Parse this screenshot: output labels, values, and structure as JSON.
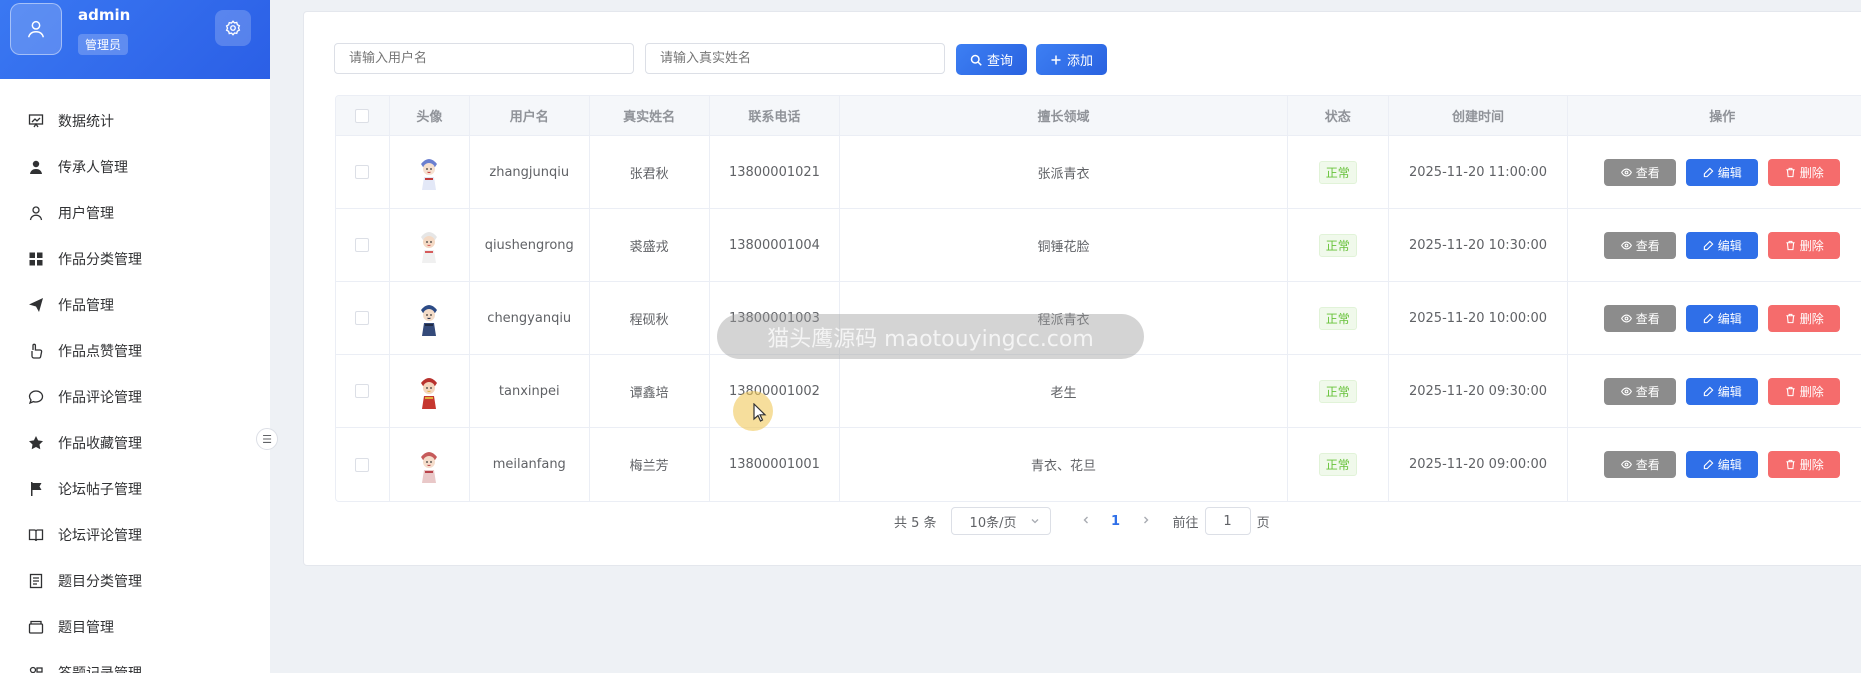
{
  "sidebar": {
    "profile": {
      "name": "admin",
      "role": "管理员"
    },
    "items": [
      {
        "label": "数据统计",
        "icon": "chart-board-icon"
      },
      {
        "label": "传承人管理",
        "icon": "user-filled-icon"
      },
      {
        "label": "用户管理",
        "icon": "user-icon"
      },
      {
        "label": "作品分类管理",
        "icon": "grid-icon"
      },
      {
        "label": "作品管理",
        "icon": "send-icon"
      },
      {
        "label": "作品点赞管理",
        "icon": "thumb-icon"
      },
      {
        "label": "作品评论管理",
        "icon": "comment-icon"
      },
      {
        "label": "作品收藏管理",
        "icon": "star-icon"
      },
      {
        "label": "论坛帖子管理",
        "icon": "flag-icon"
      },
      {
        "label": "论坛评论管理",
        "icon": "book-icon"
      },
      {
        "label": "题目分类管理",
        "icon": "tickets-icon"
      },
      {
        "label": "题目管理",
        "icon": "box-icon"
      },
      {
        "label": "答题记录管理",
        "icon": "record-icon"
      }
    ],
    "collapse_glyph": "☰"
  },
  "toolbar": {
    "username_placeholder": "请输入用户名",
    "realname_placeholder": "请输入真实姓名",
    "search_label": "查询",
    "add_label": "添加"
  },
  "table": {
    "headers": [
      "头像",
      "用户名",
      "真实姓名",
      "联系电话",
      "擅长领域",
      "状态",
      "创建时间",
      "操作"
    ],
    "rows": [
      {
        "username": "zhangjunqiu",
        "realname": "张君秋",
        "phone": "13800001021",
        "field": "张派青衣",
        "status": "正常",
        "created": "2025-11-20 11:00:00"
      },
      {
        "username": "qiushengrong",
        "realname": "裘盛戎",
        "phone": "13800001004",
        "field": "铜锤花脸",
        "status": "正常",
        "created": "2025-11-20 10:30:00"
      },
      {
        "username": "chengyanqiu",
        "realname": "程砚秋",
        "phone": "13800001003",
        "field": "程派青衣",
        "status": "正常",
        "created": "2025-11-20 10:00:00"
      },
      {
        "username": "tanxinpei",
        "realname": "谭鑫培",
        "phone": "13800001002",
        "field": "老生",
        "status": "正常",
        "created": "2025-11-20 09:30:00"
      },
      {
        "username": "meilanfang",
        "realname": "梅兰芳",
        "phone": "13800001001",
        "field": "青衣、花旦",
        "status": "正常",
        "created": "2025-11-20 09:00:00"
      }
    ],
    "actions": {
      "view": "查看",
      "edit": "编辑",
      "delete": "删除"
    }
  },
  "pagination": {
    "total": "共 5 条",
    "page_size": "10条/页",
    "current": "1",
    "goto_prefix": "前往",
    "goto_value": "1",
    "goto_suffix": "页"
  },
  "overlay": {
    "watermark": "猫头鹰源码 maotouyingcc.com"
  },
  "colors": {
    "primary": "#2f6fe8",
    "danger": "#f56c6c",
    "info": "#8c8c8c",
    "success": "#67c23a"
  }
}
